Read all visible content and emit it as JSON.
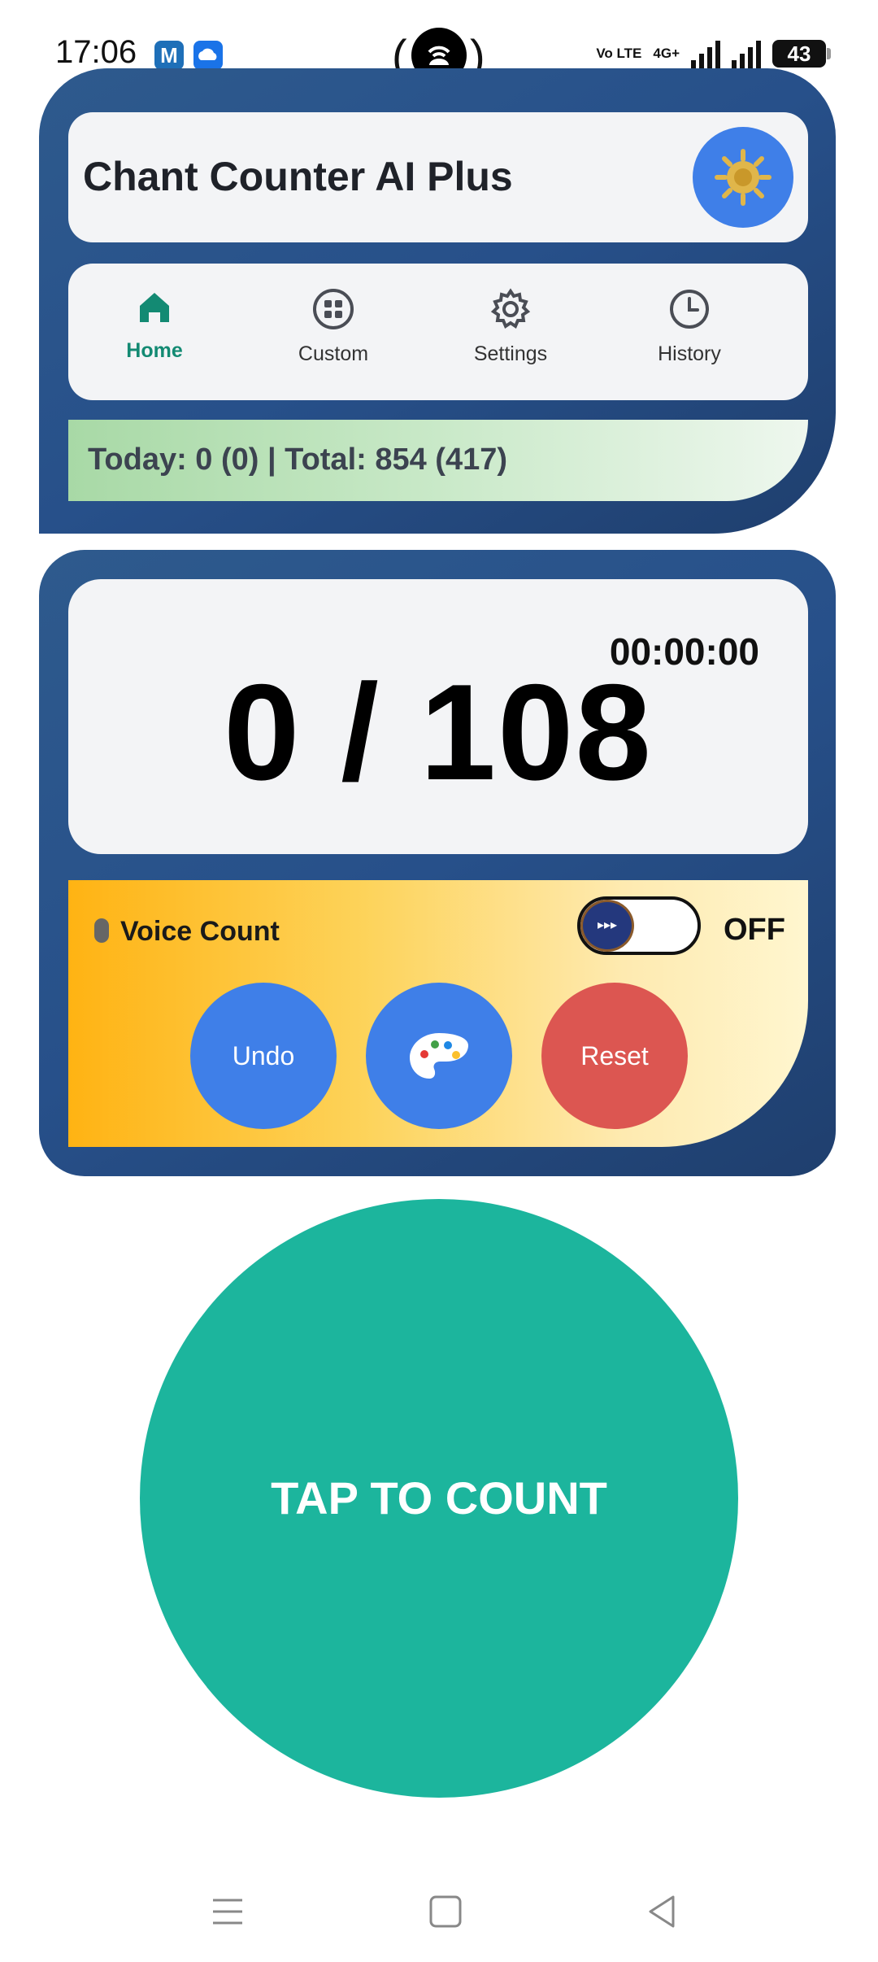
{
  "status_bar": {
    "time": "17:06",
    "network_label": "Vo LTE",
    "signal_label": "4G+",
    "battery": "43"
  },
  "header": {
    "title": "Chant Counter AI Plus"
  },
  "nav": {
    "items": [
      {
        "label": "Home",
        "icon": "home-icon",
        "active": true
      },
      {
        "label": "Custom",
        "icon": "grid-icon",
        "active": false
      },
      {
        "label": "Settings",
        "icon": "gear-icon",
        "active": false
      },
      {
        "label": "History",
        "icon": "clock-icon",
        "active": false
      }
    ]
  },
  "stats": {
    "text": "Today: 0 (0) | Total: 854 (417)"
  },
  "counter": {
    "timer": "00:00:00",
    "count": "0 / 108"
  },
  "controls": {
    "voice_label": "Voice Count",
    "voice_state": "OFF",
    "undo_label": "Undo",
    "reset_label": "Reset"
  },
  "tap": {
    "label": "TAP TO COUNT"
  },
  "colors": {
    "card_blue": "#27508a",
    "accent_teal": "#1cb59d",
    "button_blue": "#3f7fe8",
    "reset_red": "#dc5651",
    "active_nav": "#138a73"
  }
}
